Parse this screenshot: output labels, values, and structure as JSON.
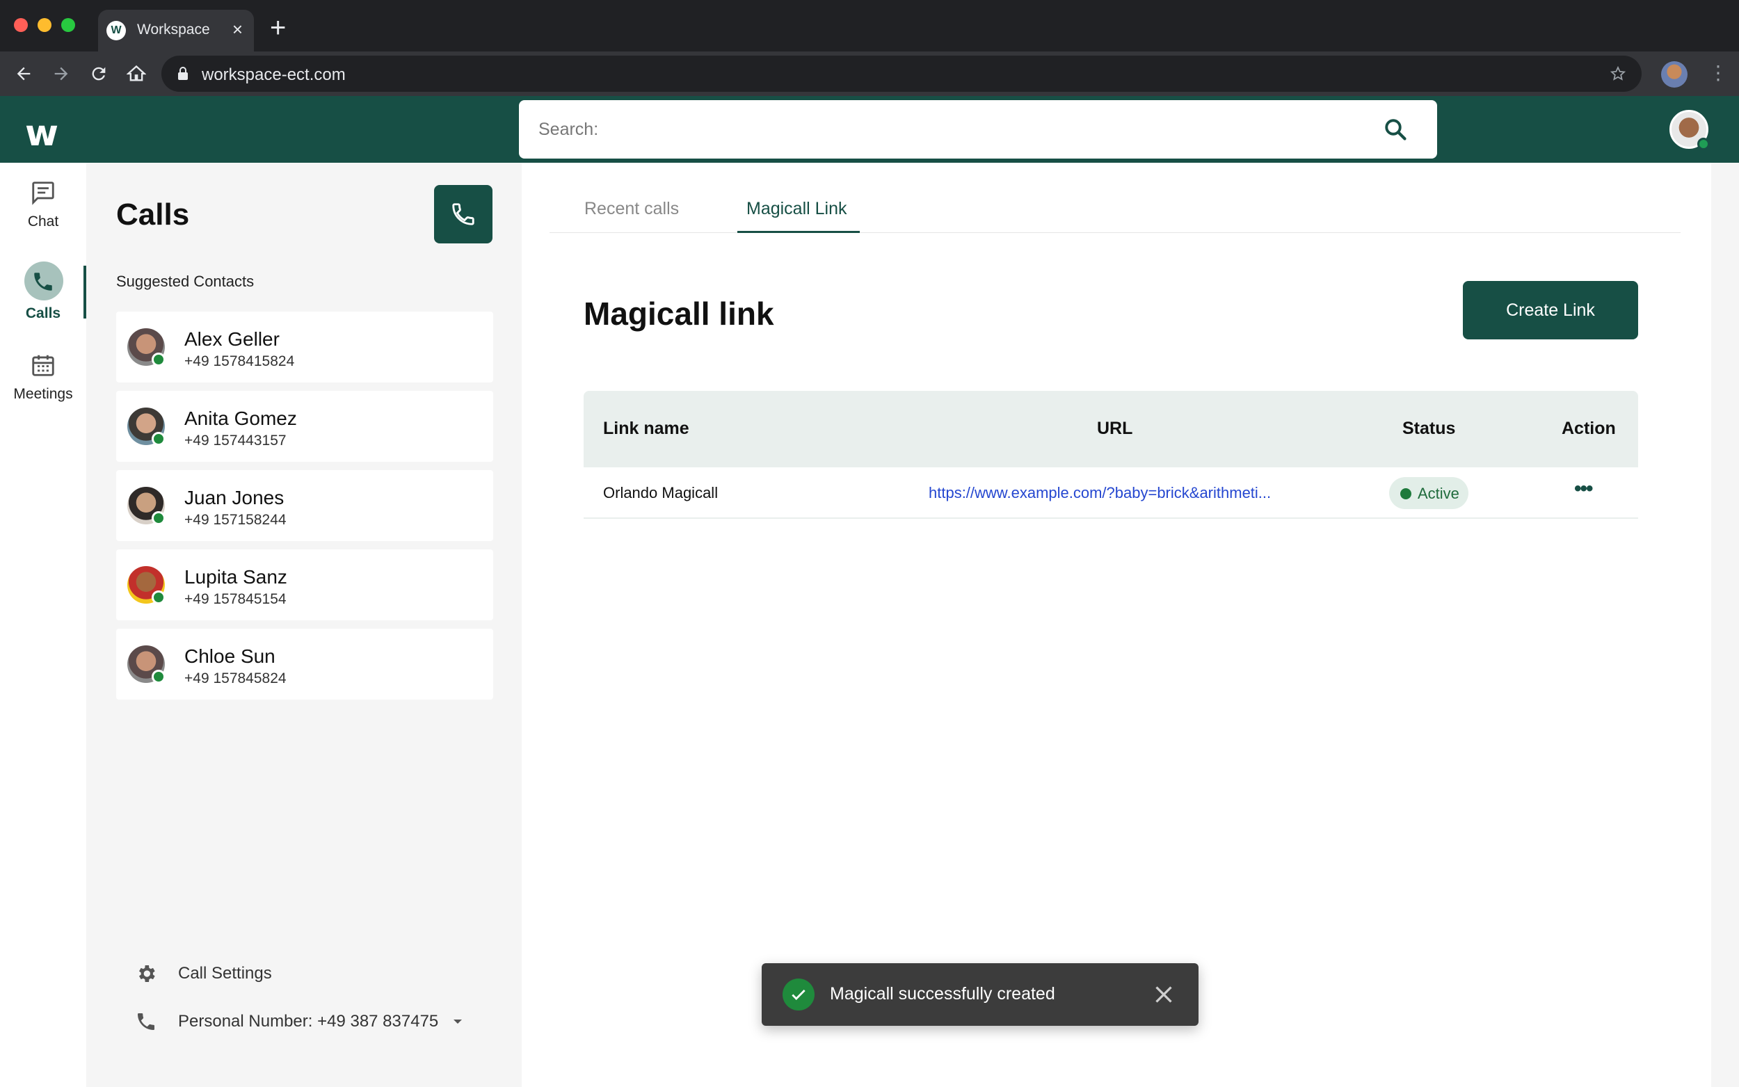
{
  "browser": {
    "tab_title": "Workspace",
    "tab_favicon": "W",
    "url": "workspace-ect.com"
  },
  "header": {
    "logo": "w",
    "search_placeholder": "Search:"
  },
  "rail": {
    "items": [
      {
        "label": "Chat",
        "icon": "chat-icon",
        "active": false
      },
      {
        "label": "Calls",
        "icon": "phone-icon",
        "active": true
      },
      {
        "label": "Meetings",
        "icon": "calendar-icon",
        "active": false
      }
    ]
  },
  "calls_panel": {
    "title": "Calls",
    "suggested_label": "Suggested Contacts",
    "contacts": [
      {
        "name": "Alex Geller",
        "phone": "+49 1578415824"
      },
      {
        "name": "Anita Gomez",
        "phone": "+49 157443157"
      },
      {
        "name": "Juan Jones",
        "phone": "+49 157158244"
      },
      {
        "name": "Lupita Sanz",
        "phone": "+49 157845154"
      },
      {
        "name": "Chloe Sun",
        "phone": "+49 157845824"
      }
    ],
    "call_settings_label": "Call Settings",
    "personal_number_label": "Personal Number: +49 387 837475"
  },
  "main": {
    "tabs": [
      {
        "label": "Recent calls",
        "active": false
      },
      {
        "label": "Magicall Link",
        "active": true
      }
    ],
    "title": "Magicall link",
    "create_button": "Create Link",
    "table": {
      "headers": {
        "name": "Link name",
        "url": "URL",
        "status": "Status",
        "action": "Action"
      },
      "rows": [
        {
          "name": "Orlando Magicall",
          "url": "https://www.example.com/?baby=brick&arithmeti...",
          "status": "Active"
        }
      ]
    }
  },
  "toast": {
    "message": "Magicall successfully created"
  },
  "colors": {
    "brand": "#174f45",
    "status_green": "#1f8a3c",
    "link_blue": "#2547d0"
  }
}
